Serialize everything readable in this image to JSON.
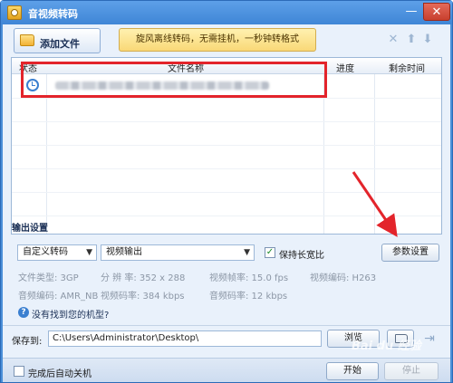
{
  "window": {
    "title": "音视频转码",
    "minimize": "—",
    "close": "✕"
  },
  "toolbar": {
    "add_file_label": "添加文件",
    "promo_text": "旋风离线转码，无需挂机，一秒钟转格式",
    "icons": [
      "delete-icon",
      "move-up-icon",
      "move-down-icon"
    ]
  },
  "file_list": {
    "columns": {
      "status": "状态",
      "name": "文件名称",
      "progress": "进度",
      "remaining": "剩余时间"
    },
    "rows": [
      {
        "status_icon": "clock-icon",
        "name": "",
        "progress": "",
        "remaining": ""
      }
    ]
  },
  "output": {
    "section_title": "输出设置",
    "preset": "自定义转码",
    "format": "视频输出",
    "keep_ratio_label": "保持长宽比",
    "keep_ratio_checked": true,
    "params_button": "参数设置",
    "info": {
      "file_type": "文件类型:  3GP",
      "resolution": "分 辨 率:  352 x 288",
      "video_fps": "视频帧率:  15.0 fps",
      "video_codec": "视频编码:  H263",
      "audio_codec": "音频编码:  AMR_NB",
      "video_bitrate": "视频码率:  384 kbps",
      "audio_bitrate": "音频码率:  12 kbps"
    },
    "help_link": "没有找到您的机型?"
  },
  "save": {
    "label": "保存到:",
    "path": "C:\\Users\\Administrator\\Desktop\\",
    "browse_button": "浏览"
  },
  "footer": {
    "shutdown_label": "完成后自动关机",
    "start_button": "开始",
    "stop_button": "停止"
  },
  "colors": {
    "highlight": "#e3242b",
    "titlebar": "#4a8fd8",
    "client": "#e9f1fb"
  },
  "watermark": "Bai du 经验"
}
